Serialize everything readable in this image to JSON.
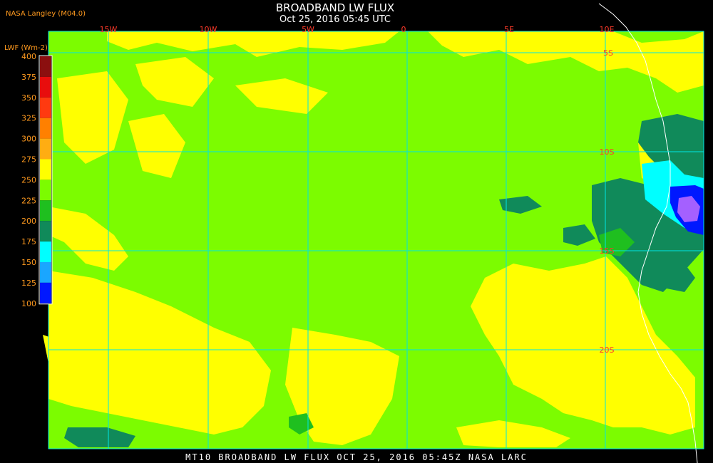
{
  "header": {
    "agency": "NASA Langley (M04.0)",
    "title": "BROADBAND LW FLUX",
    "subtitle": "Oct 25, 2016 05:45 UTC"
  },
  "footer": {
    "caption": "MT10  BROADBAND LW FLUX   OCT 25, 2016 05:45Z   NASA LARC"
  },
  "colorbar": {
    "label": "LWF (Wm-2)",
    "ticks": [
      "400",
      "375",
      "350",
      "325",
      "300",
      "275",
      "250",
      "225",
      "200",
      "175",
      "150",
      "125",
      "100"
    ],
    "colors": [
      "#8b0f0f",
      "#e80d0d",
      "#ff3a10",
      "#ff8000",
      "#ffad12",
      "#ffff00",
      "#7cfc00",
      "#1fbf1f",
      "#108a5a",
      "#00ffff",
      "#1aa6ff",
      "#0018ff",
      "#8e3be8"
    ]
  },
  "map": {
    "lon_labels": [
      "15W",
      "10W",
      "5W",
      "0",
      "5E",
      "10E"
    ],
    "lat_labels": [
      "5S",
      "10S",
      "15S",
      "20S"
    ],
    "grid_color": "#00e5e5",
    "label_color": "#ff3a2a",
    "base_color": "#7cfc00",
    "warm_color": "#ffff00",
    "cold_colors": [
      "#108a5a",
      "#1fbf1f",
      "#00ffff",
      "#0018ff",
      "#a460ff"
    ]
  }
}
